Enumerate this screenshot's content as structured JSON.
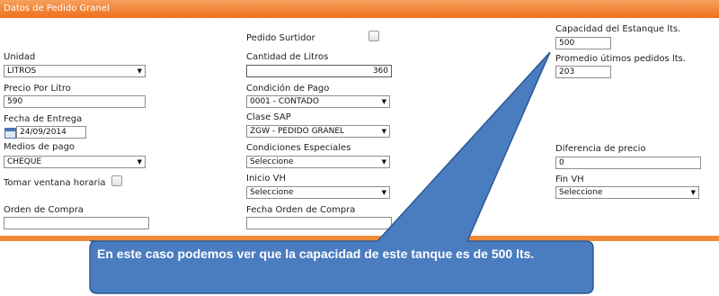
{
  "panel": {
    "title": "Datos de Pedido Granel",
    "accent": "#ee6f1c"
  },
  "left": {
    "unidad_label": "Unidad",
    "unidad_value": "LITROS",
    "precio_label": "Precio Por Litro",
    "precio_value": "590",
    "fecha_label": "Fecha de Entrega",
    "fecha_value": "24/09/2014",
    "medios_label": "Medios de pago",
    "medios_value": "CHEQUE",
    "ventana_label": "Tomar ventana horaria",
    "orden_label": "Orden de Compra",
    "orden_value": ""
  },
  "middle": {
    "surtidor_label": "Pedido Surtidor",
    "cantidad_label": "Cantidad de Litros",
    "cantidad_value": "360",
    "condicion_label": "Condición de Pago",
    "condicion_value": "0001 - CONTADO",
    "clase_label": "Clase SAP",
    "clase_value": "ZGW - PEDIDO GRANEL",
    "especiales_label": "Condiciones Especiales",
    "especiales_value": "Seleccione",
    "inicio_label": "Inicio VH",
    "inicio_value": "Seleccione",
    "fecha_orden_label": "Fecha Orden de Compra",
    "fecha_orden_value": ""
  },
  "right": {
    "capacidad_label": "Capacidad del Estanque lts.",
    "capacidad_value": "500",
    "promedio_label": "Promedio útimos pedidos lts.",
    "promedio_value": "203",
    "diferencia_label": "Diferencia de precio",
    "diferencia_value": "0",
    "fin_label": "Fin VH",
    "fin_value": "Seleccione"
  },
  "callout": {
    "text": "En este caso podemos ver que la capacidad de este tanque es de 500 lts.",
    "color": "#4a7cc0"
  }
}
